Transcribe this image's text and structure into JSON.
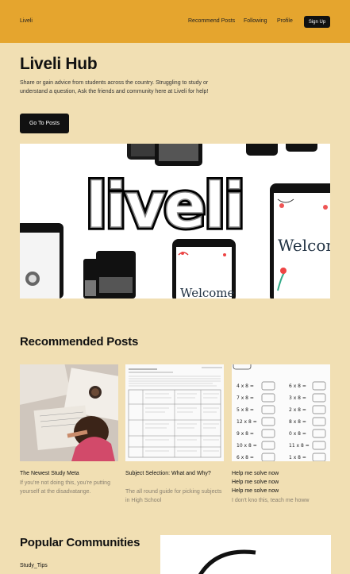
{
  "navbar": {
    "brand": "Liveli",
    "links": [
      "Recommend Posts",
      "Following",
      "Profile"
    ],
    "signup_label": "Sign Up",
    "background": "#e5a52e"
  },
  "hero": {
    "title": "Liveli Hub",
    "description": "Share or gain advice from students across the country. Struggling to study or understand a question, Ask the friends and community here at Liveli for help!",
    "cta_label": "Go To Posts"
  },
  "banner": {
    "logo_text": "liveli",
    "phone_text": "Welcome"
  },
  "recommended": {
    "title": "Recommended Posts",
    "posts": [
      {
        "title": "The Newest Study Meta",
        "description": "If you're not doing this, you're putting yourself at the disadvatange."
      },
      {
        "title": "Subject Selection: What and Why?",
        "description": "The all round guide for picking subjects in High School"
      },
      {
        "title": "Help me solve now\nHelp me solve now\nHelp me solve now",
        "description": "I don't kno this, teach me howw"
      }
    ]
  },
  "communities": {
    "title": "Popular Communities",
    "items": [
      "Study_Tips"
    ]
  },
  "colors": {
    "background": "#f1dfb3",
    "accent": "#e5a52e",
    "button": "#111111"
  }
}
